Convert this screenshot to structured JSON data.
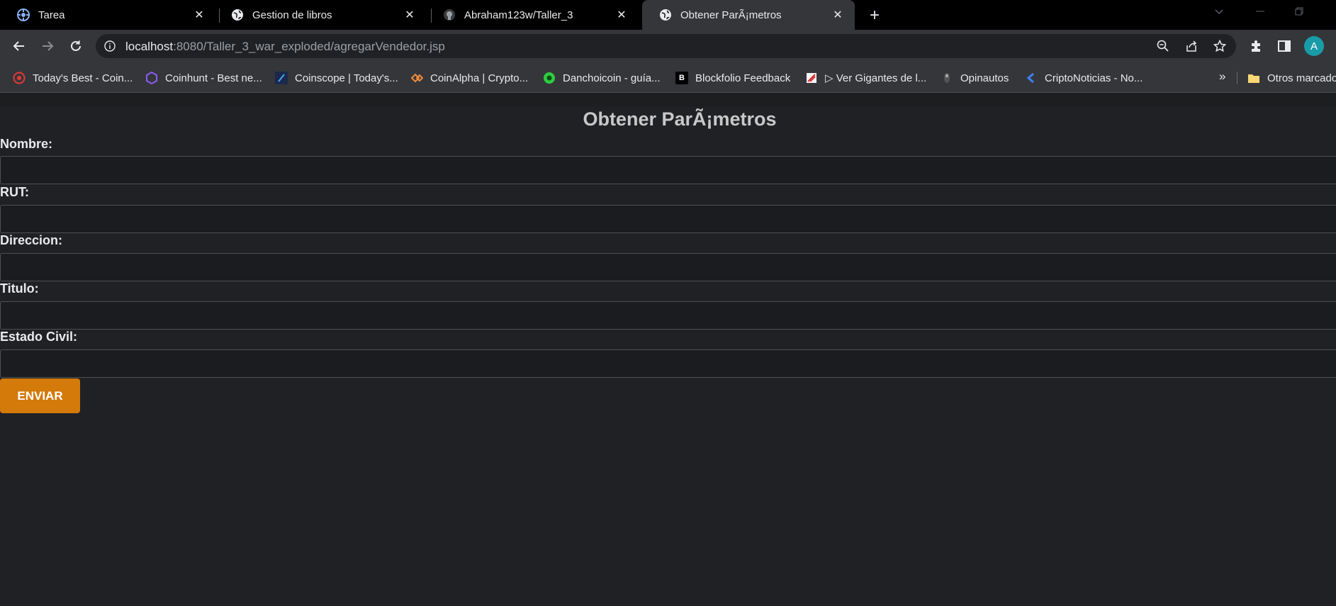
{
  "tabs": [
    {
      "title": "Tarea",
      "icon": "settings-wheel-icon"
    },
    {
      "title": "Gestion de libros",
      "icon": "globe-icon"
    },
    {
      "title": "Abraham123w/Taller_3",
      "icon": "github-icon"
    },
    {
      "title": "Obtener ParÃ¡metros",
      "icon": "globe-icon",
      "active": true
    }
  ],
  "address_bar": {
    "host": "localhost",
    "rest": ":8080/Taller_3_war_exploded/agregarVendedor.jsp"
  },
  "profile": {
    "initial": "A"
  },
  "bookmarks": [
    {
      "label": "Today's Best - Coin...",
      "icon": "coin-red-icon"
    },
    {
      "label": "Coinhunt - Best ne...",
      "icon": "coinhunt-icon"
    },
    {
      "label": "Coinscope | Today's...",
      "icon": "coinscope-icon"
    },
    {
      "label": "CoinAlpha | Crypto...",
      "icon": "coinalpha-icon"
    },
    {
      "label": "Danchoicoin - guía...",
      "icon": "danchoicoin-icon"
    },
    {
      "label": "Blockfolio Feedback",
      "icon": "blockfolio-icon"
    },
    {
      "label": "▷ Ver Gigantes de l...",
      "icon": "gigantes-icon"
    },
    {
      "label": "Opinautos",
      "icon": "opinautos-icon"
    },
    {
      "label": "CriptoNoticias - No...",
      "icon": "criptonoticias-icon"
    }
  ],
  "other_bookmarks": "Otros marcadores",
  "page": {
    "title": "Obtener ParÃ¡metros",
    "fields": [
      {
        "label": "Nombre:",
        "value": ""
      },
      {
        "label": "RUT:",
        "value": ""
      },
      {
        "label": "Direccion:",
        "value": ""
      },
      {
        "label": "Titulo:",
        "value": ""
      },
      {
        "label": "Estado Civil:",
        "value": ""
      }
    ],
    "submit_label": "ENVIAR"
  },
  "colors": {
    "page_bg": "#202124",
    "submit_bg": "#d37a0a",
    "title_color": "#c8c8c8"
  }
}
